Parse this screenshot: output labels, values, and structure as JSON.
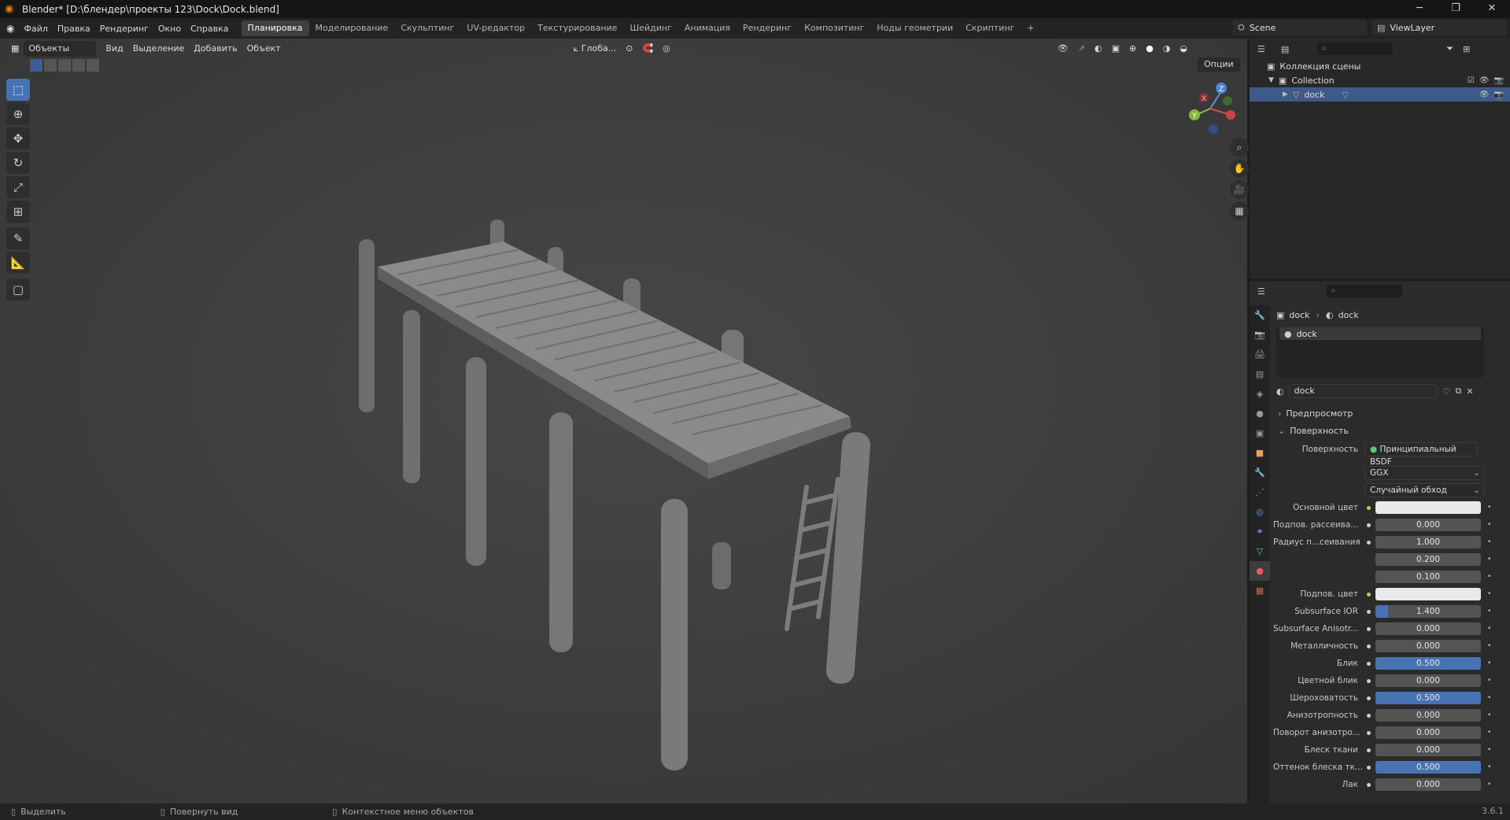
{
  "window": {
    "title": "Blender* [D:\\блендер\\проекты 123\\Dock\\Dock.blend]",
    "btn_minimize": "─",
    "btn_restore": "❐",
    "btn_close": "✕"
  },
  "menu": {
    "items": [
      "Файл",
      "Правка",
      "Рендеринг",
      "Окно",
      "Справка"
    ]
  },
  "workspaces": {
    "tabs": [
      "Планировка",
      "Моделирование",
      "Скульптинг",
      "UV-редактор",
      "Текстурирование",
      "Шейдинг",
      "Анимация",
      "Рендеринг",
      "Композитинг",
      "Ноды геометрии",
      "Скриптинг"
    ],
    "add": "+"
  },
  "scene": {
    "name": "Scene",
    "view_layer": "ViewLayer"
  },
  "viewport": {
    "mode": "Объекты",
    "menu": [
      "Вид",
      "Выделение",
      "Добавить",
      "Объект"
    ],
    "orientation": "Глоба...",
    "options": "Опции",
    "gizmo": {
      "x": "X",
      "y": "Y",
      "z": "Z"
    }
  },
  "outliner": {
    "root": "Коллекция сцены",
    "collection": "Collection",
    "object": "dock"
  },
  "properties": {
    "breadcrumb": [
      "dock",
      "dock"
    ],
    "slot_name": "dock",
    "material_name": "dock",
    "sections": {
      "preview": "Предпросмотр",
      "surface": "Поверхность"
    },
    "surface_shader_label": "Поверхность",
    "surface_shader": "Принципиальный BSDF",
    "distribution": "GGX",
    "subsurface_method": "Случайный обход",
    "rows": [
      {
        "label": "Основной цвет",
        "type": "color",
        "value": ""
      },
      {
        "label": "Подпов. рассеива...",
        "type": "number",
        "value": "0.000",
        "fill": 0
      },
      {
        "label": "Радиус п...сеивания",
        "type": "number",
        "value": "1.000",
        "fill": 0
      },
      {
        "label": "",
        "type": "number",
        "value": "0.200",
        "fill": 0
      },
      {
        "label": "",
        "type": "number",
        "value": "0.100",
        "fill": 0
      },
      {
        "label": "Подпов. цвет",
        "type": "color",
        "value": ""
      },
      {
        "label": "Subsurface IOR",
        "type": "number",
        "value": "1.400",
        "fill": 0.12
      },
      {
        "label": "Subsurface Anisotr...",
        "type": "number",
        "value": "0.000",
        "fill": 0
      },
      {
        "label": "Металличность",
        "type": "number",
        "value": "0.000",
        "fill": 0
      },
      {
        "label": "Блик",
        "type": "number",
        "value": "0.500",
        "fill": 1.0
      },
      {
        "label": "Цветной блик",
        "type": "number",
        "value": "0.000",
        "fill": 0
      },
      {
        "label": "Шероховатость",
        "type": "number",
        "value": "0.500",
        "fill": 1.0
      },
      {
        "label": "Анизотропность",
        "type": "number",
        "value": "0.000",
        "fill": 0
      },
      {
        "label": "Поворот анизотро...",
        "type": "number",
        "value": "0.000",
        "fill": 0
      },
      {
        "label": "Блеск ткани",
        "type": "number",
        "value": "0.000",
        "fill": 0
      },
      {
        "label": "Оттенок блеска тк...",
        "type": "number",
        "value": "0.500",
        "fill": 1.0
      },
      {
        "label": "Лак",
        "type": "number",
        "value": "0.000",
        "fill": 0
      }
    ]
  },
  "status": {
    "select": "Выделить",
    "rotate": "Повернуть вид",
    "context": "Контекстное меню объектов",
    "version": "3.6.1"
  },
  "colors": {
    "accent": "#4772b3",
    "selection": "#3d5a8a",
    "viewport_bg": "#3d3d3d"
  }
}
